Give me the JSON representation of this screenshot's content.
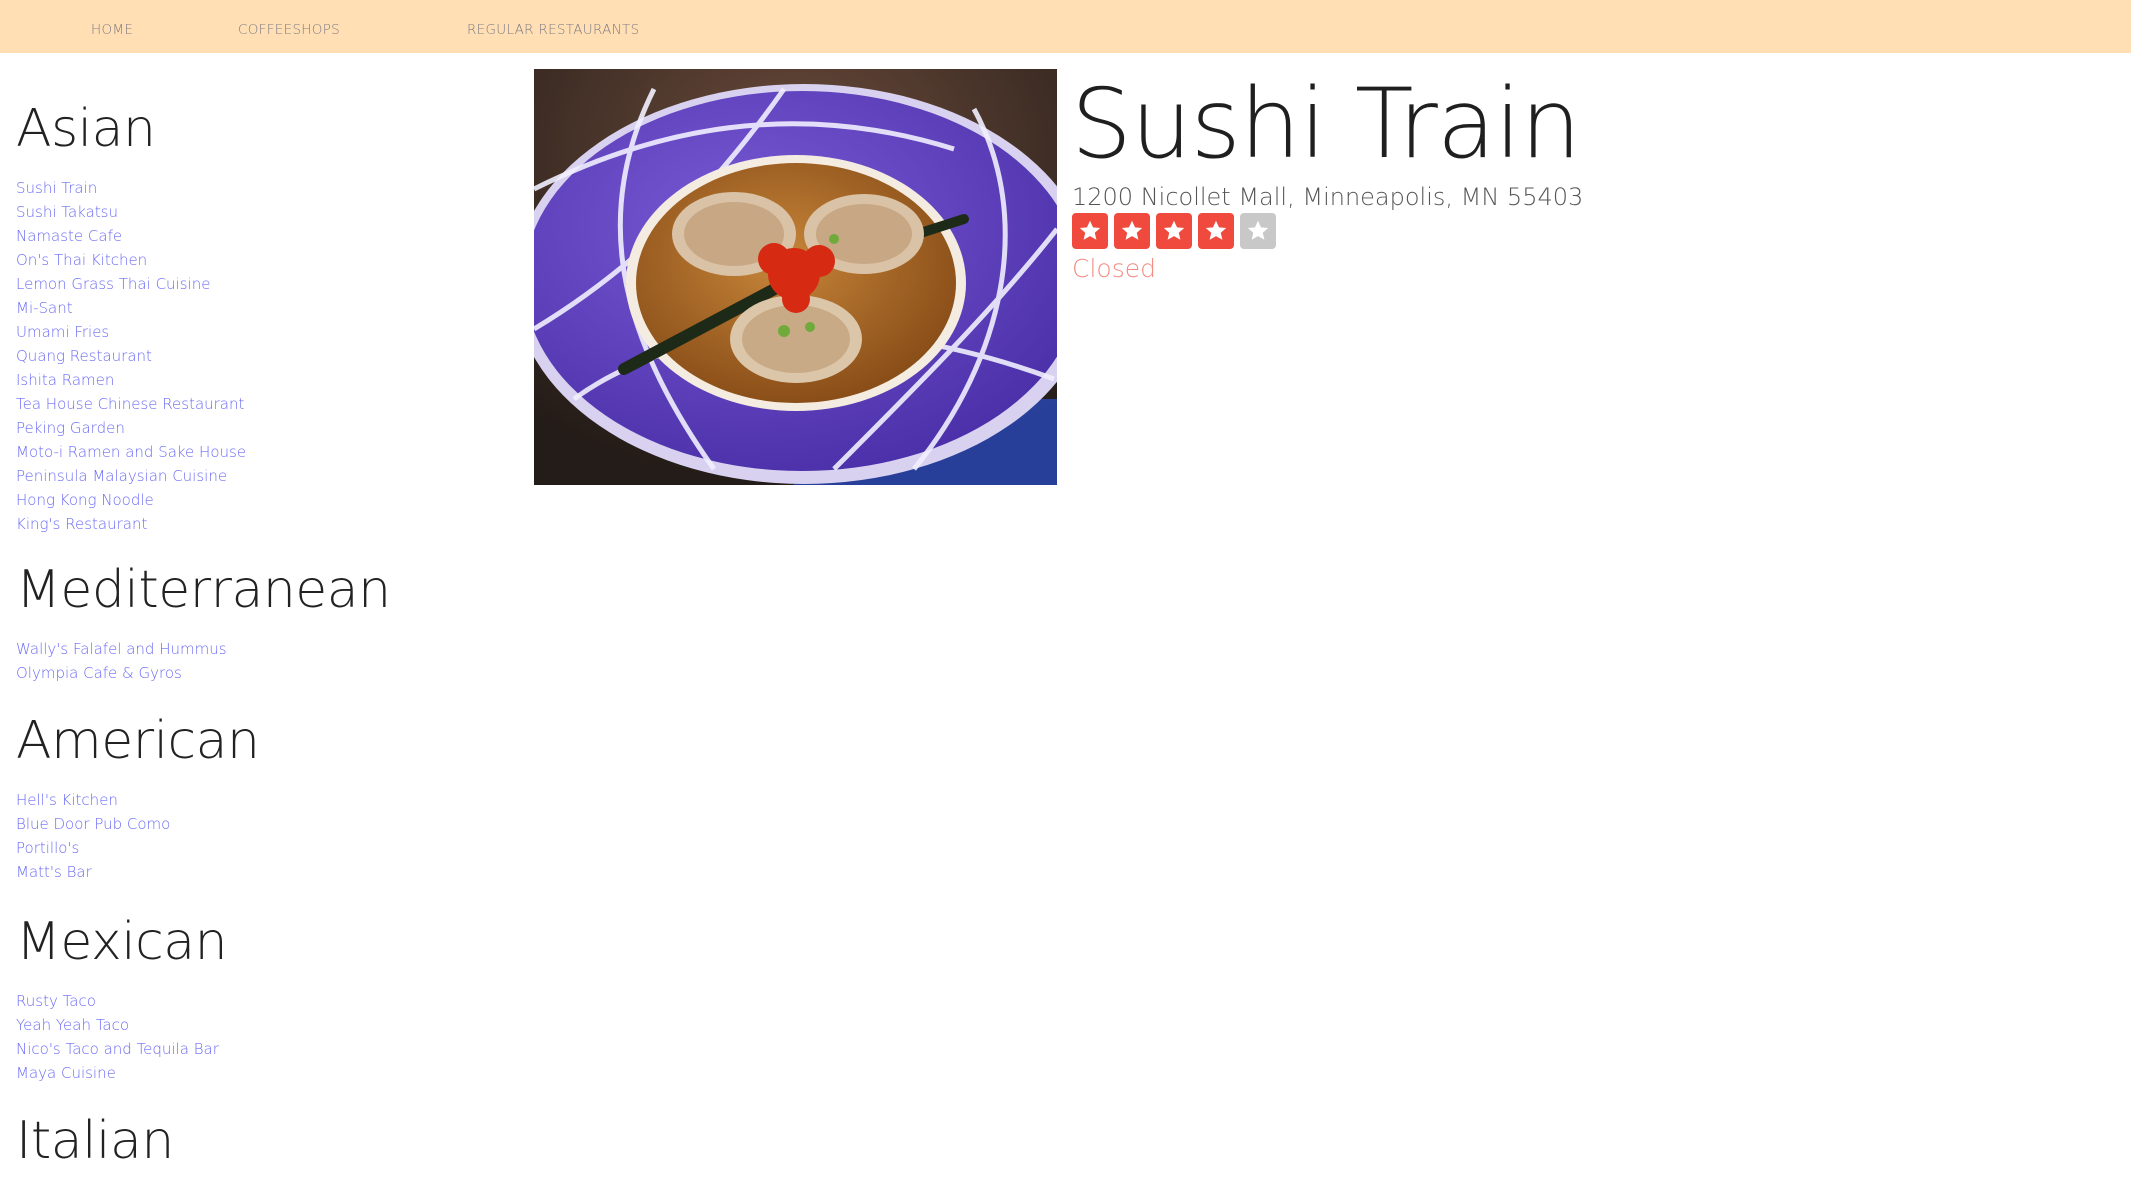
{
  "nav": {
    "home": "HOME",
    "coffeeshops": "COFFEESHOPS",
    "regular_restaurants": "REGULAR RESTAURANTS"
  },
  "categories": [
    {
      "title": "Asian",
      "items": [
        "Sushi Train",
        "Sushi Takatsu",
        "Namaste Cafe",
        "On's Thai Kitchen",
        "Lemon Grass Thai Cuisine",
        "Mi-Sant",
        "Umami Fries",
        "Quang Restaurant",
        "Ishita Ramen",
        "Tea House Chinese Restaurant",
        "Peking Garden",
        "Moto-i Ramen and Sake House",
        "Peninsula Malaysian Cuisine",
        "Hong Kong Noodle",
        "King's Restaurant"
      ]
    },
    {
      "title": "Mediterranean",
      "items": [
        "Wally's Falafel and Hummus",
        "Olympia Cafe & Gyros"
      ]
    },
    {
      "title": "American",
      "items": [
        "Hell's Kitchen",
        "Blue Door Pub Como",
        "Portillo's",
        "Matt's Bar"
      ]
    },
    {
      "title": "Mexican",
      "items": [
        "Rusty Taco",
        "Yeah Yeah Taco",
        "Nico's Taco and Tequila Bar",
        "Maya Cuisine"
      ]
    },
    {
      "title": "Italian",
      "items": []
    }
  ],
  "detail": {
    "name": "Sushi Train",
    "address": "1200 Nicollet Mall, Minneapolis, MN 55403",
    "rating": 4,
    "rating_max": 5,
    "status": "Closed"
  },
  "colors": {
    "nav_bg": "#ffdfb3",
    "link": "#6b6bf5",
    "star_on": "#f04a3e",
    "star_off": "#c8c8c8",
    "status_closed": "#f28c82"
  },
  "icons": {
    "star": "star-icon",
    "photo": "food-photo"
  }
}
